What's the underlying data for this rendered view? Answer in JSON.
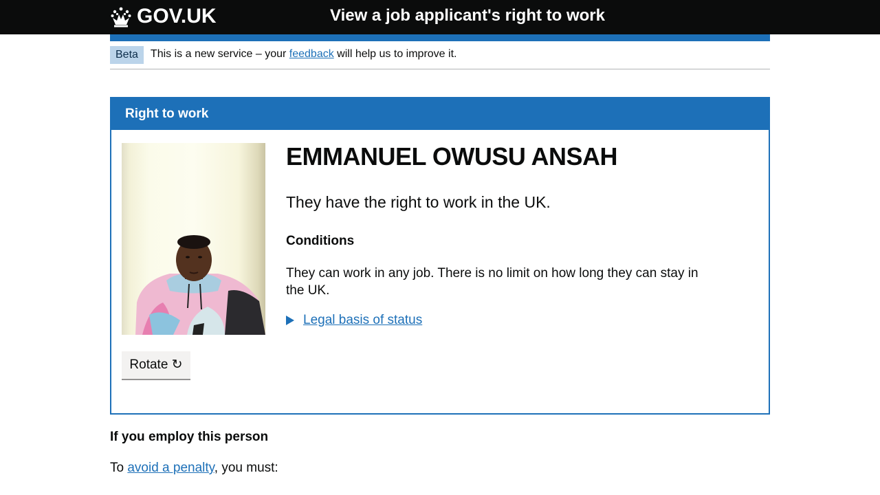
{
  "header": {
    "logo_text": "GOV.UK",
    "logo_icon": "crown-icon",
    "service_name": "View a job applicant's right to work"
  },
  "phase_banner": {
    "tag": "Beta",
    "text_before": "This is a new service – your ",
    "link": "feedback",
    "text_after": " will help us to improve it."
  },
  "panel": {
    "heading": "Right to work",
    "name": "EMMANUEL OWUSU ANSAH",
    "status": "They have the right to work in the UK.",
    "conditions_title": "Conditions",
    "conditions_text": "They can work in any job. There is no limit on how long they can stay in the UK.",
    "details_link": "Legal basis of status",
    "rotate_button": "Rotate ↻",
    "photo_icon": "applicant-photo"
  },
  "employ": {
    "title": "If you employ this person",
    "text_before": "To ",
    "link": "avoid a penalty",
    "text_after": ", you must:"
  },
  "colors": {
    "header_bg": "#0b0c0c",
    "brand_blue": "#1d70b8",
    "phase_tag_bg": "#bbd4ea"
  }
}
